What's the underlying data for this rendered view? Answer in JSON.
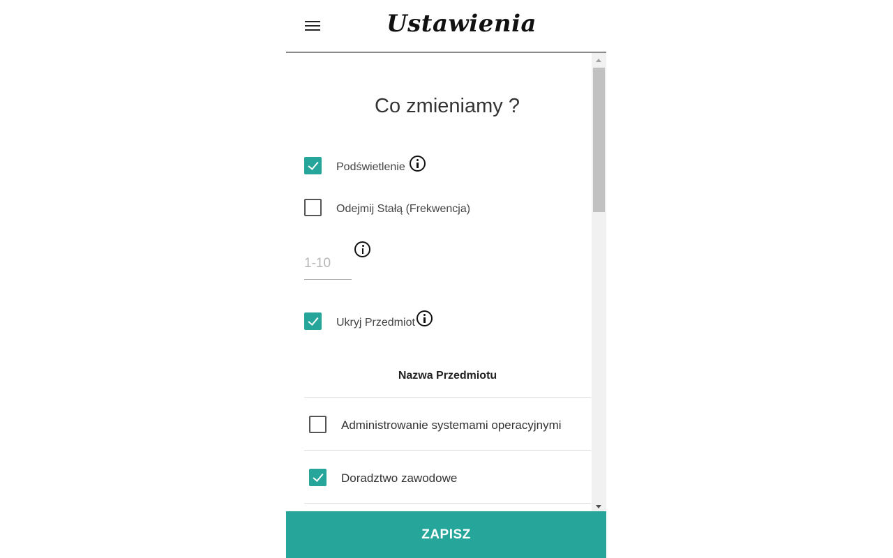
{
  "header": {
    "title": "Ustawienia",
    "menu_icon": "hamburger-menu-icon"
  },
  "main": {
    "heading": "Co zmieniamy ?",
    "options": {
      "highlight": {
        "label": "Podświetlenie",
        "checked": true
      },
      "subtract_constant": {
        "label": "Odejmij Stałą (Frekwencja)",
        "checked": false
      },
      "constant_input": {
        "value": "",
        "placeholder": "1-10"
      },
      "hide_subject": {
        "label": "Ukryj Przedmiot",
        "checked": true
      }
    },
    "subjects_table": {
      "header": "Nazwa Przedmiotu",
      "rows": [
        {
          "label": "Administrowanie systemami operacyjnymi",
          "checked": false
        },
        {
          "label": "Doradztwo zawodowe",
          "checked": true
        }
      ]
    }
  },
  "footer": {
    "save_label": "ZAPISZ"
  },
  "colors": {
    "accent": "#26a69a"
  }
}
